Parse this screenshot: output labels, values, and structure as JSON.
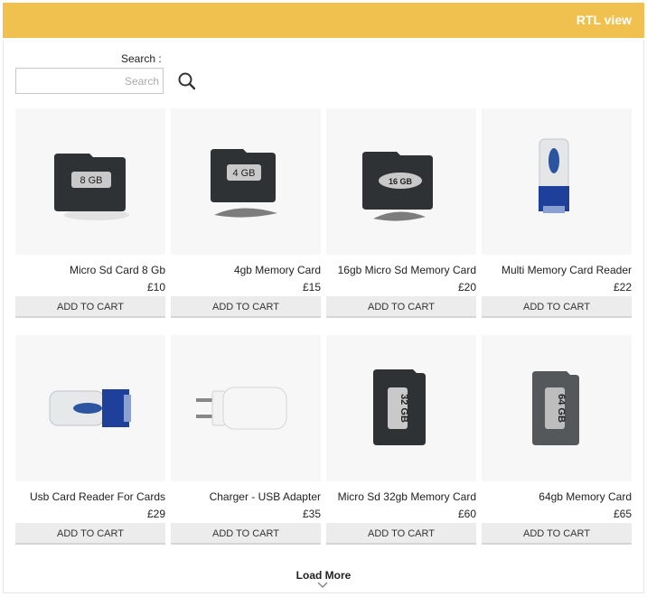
{
  "header": {
    "title": "RTL view",
    "accent": "#f1c150"
  },
  "search": {
    "label": "Search :",
    "placeholder": "Search",
    "icon": "search-icon"
  },
  "products": [
    {
      "name": "Micro Sd Card 8 Gb",
      "price": "£10",
      "button": "ADD TO CART",
      "image": "microsd-8gb",
      "card_label": "8 GB"
    },
    {
      "name": "4gb Memory Card",
      "price": "£15",
      "button": "ADD TO CART",
      "image": "microsd-4gb",
      "card_label": "4 GB"
    },
    {
      "name": "16gb Micro Sd Memory Card",
      "price": "£20",
      "button": "ADD TO CART",
      "image": "microsd-16gb",
      "card_label": "16 GB"
    },
    {
      "name": "Multi Memory Card Reader",
      "price": "£22",
      "button": "ADD TO CART",
      "image": "card-reader-vertical",
      "card_label": ""
    },
    {
      "name": "Usb Card Reader For Cards",
      "price": "£29",
      "button": "ADD TO CART",
      "image": "usb-card-reader",
      "card_label": ""
    },
    {
      "name": "Charger - USB Adapter",
      "price": "£35",
      "button": "ADD TO CART",
      "image": "usb-charger",
      "card_label": ""
    },
    {
      "name": "Micro Sd 32gb Memory Card",
      "price": "£60",
      "button": "ADD TO CART",
      "image": "microsd-32gb",
      "card_label": "32 GB"
    },
    {
      "name": "64gb Memory Card",
      "price": "£65",
      "button": "ADD TO CART",
      "image": "microsd-64gb",
      "card_label": "64 GB"
    }
  ],
  "load_more": {
    "label": "Load More",
    "icon": "chevron-down-icon"
  }
}
